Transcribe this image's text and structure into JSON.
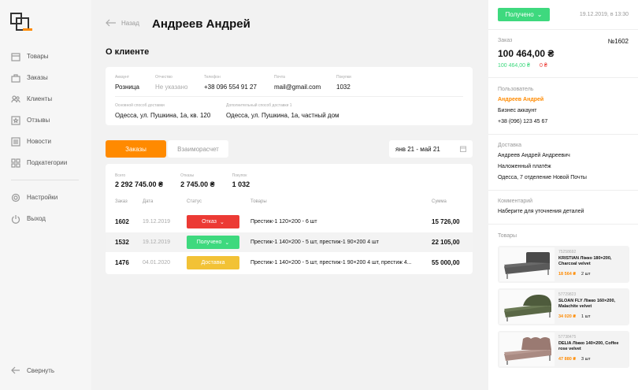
{
  "nav": {
    "items": [
      {
        "label": "Товары",
        "icon": "box-icon"
      },
      {
        "label": "Заказы",
        "icon": "bag-icon"
      },
      {
        "label": "Клиенты",
        "icon": "users-icon"
      },
      {
        "label": "Отзывы",
        "icon": "review-icon"
      },
      {
        "label": "Новости",
        "icon": "news-icon"
      },
      {
        "label": "Подкатегории",
        "icon": "grid-icon"
      }
    ],
    "settings": "Настройки",
    "logout": "Выход",
    "collapse": "Свернуть"
  },
  "header": {
    "back": "Назад",
    "title": "Андреев Андрей"
  },
  "client": {
    "section_title": "О клиенте",
    "account_label": "Аккаунт",
    "account": "Розница",
    "patronymic_label": "Отчество",
    "patronymic": "Не указано",
    "phone_label": "Телефон",
    "phone": "+38 096 554 91 27",
    "email_label": "Почта",
    "email": "mail@gmail.com",
    "purchases_label": "Покупки",
    "purchases": "1032",
    "address1_label": "Основной способ доставки",
    "address1": "Одесса, ул. Пушкина, 1а, кв. 120",
    "address2_label": "Дополнительный способ доставки 1",
    "address2": "Одесса, ул. Пушкина, 1а, частный дом"
  },
  "tabs": {
    "orders": "Заказы",
    "mutual": "Взаиморасчет"
  },
  "daterange": "янв 21 - май 21",
  "orders": {
    "total_label": "Всего",
    "total": "2 292 745.00 ₴",
    "refunds_label": "Отказы",
    "refunds": "2 745.00 ₴",
    "purchases_label": "Покупок",
    "purchases": "1 032",
    "columns": [
      "Заказ",
      "Дата",
      "Статус",
      "Товары",
      "Сумма"
    ],
    "rows": [
      {
        "num": "1602",
        "date": "19.12.2019",
        "status": "Отказ",
        "status_color": "#ec3a34",
        "items": "Престиж-1 120×200 - 6 шт",
        "sum": "15 726,00"
      },
      {
        "num": "1532",
        "date": "19.12.2019",
        "status": "Получено",
        "status_color": "#3ed97e",
        "items": "Престиж-1 140×200 - 5 шт, престиж-1 90×200 4 шт",
        "sum": "22 105,00"
      },
      {
        "num": "1476",
        "date": "04.01.2020",
        "status": "Доставка",
        "status_color": "#f2c236",
        "items": "Престиж-1 140×200 - 5 шт, престиж-1 90×200 4 шт, престиж 4...",
        "sum": "55 000,00"
      }
    ]
  },
  "order_panel": {
    "status": "Получено",
    "datetime": "19.12.2019, в 13:30",
    "order_label": "Заказ",
    "order_num": "№1602",
    "amount": "100 464,00 ₴",
    "amount_green": "100 464,00 ₴",
    "amount_red": "0 ₴",
    "user_label": "Пользователь",
    "user_name": "Андреев Андрей",
    "user_type": "Бизнес аккаунт",
    "user_phone": "+38 (096) 123 45 67",
    "delivery_label": "Доставка",
    "delivery_name": "Андреев Андрей Андреевич",
    "delivery_method": "Наложенный платёж",
    "delivery_address": "Одесса, 7 отделение Новой Почты",
    "comment_label": "Комментарий",
    "comment": "Наберите для уточнения деталей",
    "products_label": "Товары",
    "products": [
      {
        "sku": "75258692",
        "name": "KRISTIAN Ліжко 180×200, Charcoal velvet",
        "price": "18 564 ₴",
        "qty": "2 шт",
        "color": "#4a4a4a"
      },
      {
        "sku": "57729823",
        "name": "SLOAN FLY Ліжко 160×200, Malachite velvet",
        "price": "34 020 ₴",
        "qty": "1 шт",
        "color": "#4e5b3c"
      },
      {
        "sku": "57738475",
        "name": "DELIA Ліжко 140×200, Coffee rose velvet",
        "price": "47 880 ₴",
        "qty": "3 шт",
        "color": "#9a7a72"
      }
    ]
  }
}
